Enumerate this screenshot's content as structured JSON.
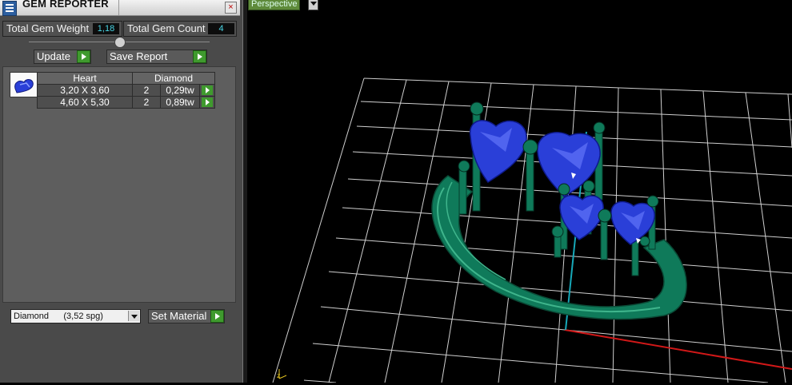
{
  "window": {
    "title": "GEM REPORTER",
    "close_glyph": "×"
  },
  "stats": {
    "total_weight_label": "Total Gem Weight",
    "total_weight_value": "1,18",
    "total_count_label": "Total Gem Count",
    "total_count_value": "4"
  },
  "toolbar": {
    "update_label": "Update",
    "save_label": "Save Report"
  },
  "table": {
    "headers": [
      "Heart",
      "Diamond"
    ],
    "rows": [
      {
        "size": "3,20 X 3,60",
        "qty": "2",
        "weight": "0,29tw"
      },
      {
        "size": "4,60 X 5,30",
        "qty": "2",
        "weight": "0,89tw"
      }
    ]
  },
  "material": {
    "selected": "Diamond      (3,52 spg)",
    "set_label": "Set Material"
  },
  "viewport": {
    "view_label": "Perspective",
    "axis_label": "z"
  },
  "colors": {
    "gem": "#2a3fd8",
    "metal": "#0f7a5a",
    "grid": "#cfcfcf",
    "x_axis": "#d11818",
    "z_axis": "#17a8b8"
  }
}
